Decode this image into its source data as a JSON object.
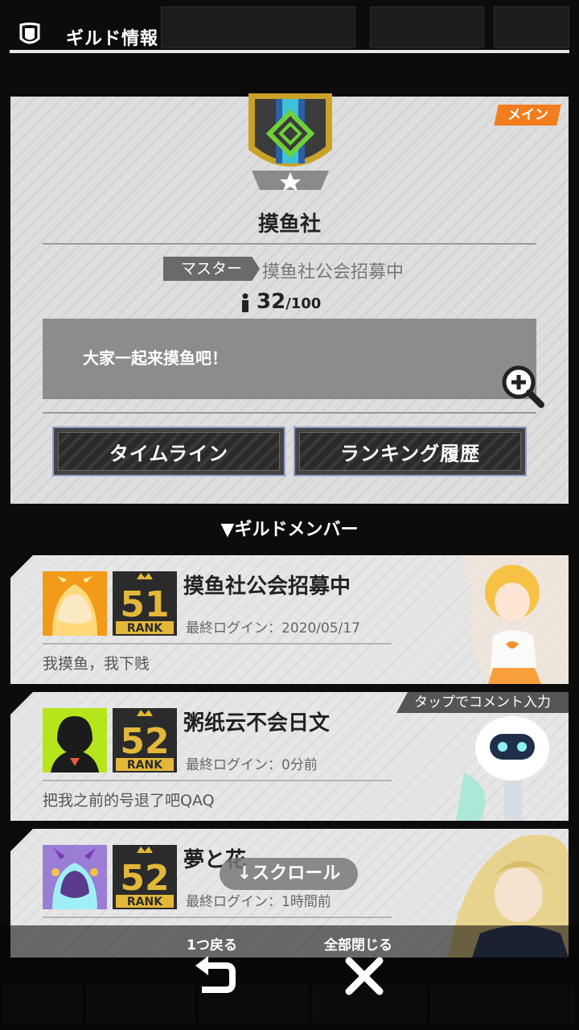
{
  "header": {
    "title": "ギルド情報"
  },
  "guild": {
    "tag": "メイン",
    "name": "摸鱼社",
    "master_label": "マスター",
    "master_name": "摸鱼社公会招募中",
    "member_count": "32",
    "member_max": "/100",
    "comment": "大家一起来摸鱼吧！",
    "buttons": {
      "timeline": "タイムライン",
      "ranking": "ランキング履歴"
    }
  },
  "members_heading": "▼ギルドメンバー",
  "members": [
    {
      "name": "摸鱼社公会招募中",
      "rank": "51",
      "rank_label": "RANK",
      "last_login": "最終ログイン：2020/05/17",
      "comment": "我摸鱼，我下贱",
      "avatar_color": "#f39a1a"
    },
    {
      "name": "粥纸云不会日文",
      "rank": "52",
      "rank_label": "RANK",
      "last_login": "最終ログイン：0分前",
      "comment": "把我之前的号退了吧QAQ",
      "avatar_color": "#b6e61a"
    },
    {
      "name": "夢と花",
      "rank": "52",
      "rank_label": "RANK",
      "last_login": "最終ログイン：1時間前",
      "comment": "",
      "avatar_color": "#9a7ed6"
    }
  ],
  "tap_banner": "タップでコメント入力",
  "scroll_hint": "↓スクロール",
  "controls": {
    "back_label": "1つ戻る",
    "close_all_label": "全部閉じる"
  },
  "colors": {
    "accent_orange": "#f27d1e",
    "rank_gold": "#e3b83a",
    "emblem_green": "#6fd13a"
  }
}
